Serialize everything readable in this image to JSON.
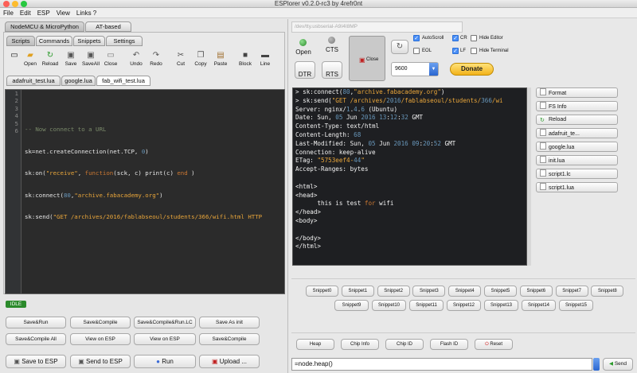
{
  "window": {
    "title": "ESPlorer v0.2.0-rc3 by 4refr0nt"
  },
  "menu": [
    "File",
    "Edit",
    "ESP",
    "View",
    "Links ?"
  ],
  "left": {
    "firmware_tabs": [
      "NodeMCU & MicroPython",
      "AT-based"
    ],
    "sub_tabs": [
      "Scripts",
      "Commands",
      "Snippets",
      "Settings"
    ],
    "toolbar": [
      {
        "label": "Open",
        "icon": "new-file-icon"
      },
      {
        "label": "Open",
        "icon": "open-folder-icon"
      },
      {
        "label": "Reload",
        "icon": "reload-icon"
      },
      {
        "label": "Save",
        "icon": "save-icon"
      },
      {
        "label": "SaveAll",
        "icon": "save-all-icon"
      },
      {
        "label": "Close",
        "icon": "close-file-icon"
      },
      {
        "label": "Undo",
        "icon": "undo-icon"
      },
      {
        "label": "Redo",
        "icon": "redo-icon"
      },
      {
        "label": "Cut",
        "icon": "cut-icon"
      },
      {
        "label": "Copy",
        "icon": "copy-icon"
      },
      {
        "label": "Paste",
        "icon": "paste-icon"
      },
      {
        "label": "Block",
        "icon": "block-icon"
      },
      {
        "label": "Line",
        "icon": "line-icon"
      }
    ],
    "file_tabs": [
      "adafruit_test.lua",
      "google.lua",
      "fab_wifi_test.lua"
    ],
    "line_numbers": [
      "1",
      "2",
      "3",
      "4",
      "5",
      "6"
    ],
    "status": "IDLE",
    "actions_row1": [
      "Save&Run",
      "Save&Compile",
      "Save&Compile&Run.LC",
      "Save As init"
    ],
    "actions_row2": [
      "Save&Compile All",
      "View on ESP",
      "View on ESP",
      "Save&Compile"
    ],
    "actions_row3": [
      "Save to ESP",
      "Send to ESP",
      "Run",
      "Upload ..."
    ]
  },
  "right": {
    "port": "/dev/tty.usbserial-A9I4I8MP",
    "open_label": "Open",
    "cts_label": "CTS",
    "dtr_label": "DTR",
    "rts_label": "RTS",
    "close_label": "Close",
    "checkboxes": [
      {
        "label": "AutoScroll",
        "checked": true
      },
      {
        "label": "EOL",
        "checked": false
      },
      {
        "label": "CR",
        "checked": true
      },
      {
        "label": "LF",
        "checked": true
      },
      {
        "label": "Hide Editor",
        "checked": false
      },
      {
        "label": "Hide Terminal",
        "checked": false
      }
    ],
    "baud": "9600",
    "donate_label": "Donate",
    "terminal_lines": [
      "> sk:connect(80,\"archive.fabacademy.org\")",
      "> sk:send(\"GET /archives/2016/fablabseoul/students/366/wi",
      "Server: nginx/1.4.6 (Ubuntu)",
      "Date: Sun, 05 Jun 2016 13:12:32 GMT",
      "Content-Type: text/html",
      "Content-Length: 68",
      "Last-Modified: Sun, 05 Jun 2016 09:20:52 GMT",
      "Connection: keep-alive",
      "ETag: \"5753eef4-44\"",
      "Accept-Ranges: bytes",
      "",
      "<html>",
      "<head>",
      "      this is test for wifi",
      "</head>",
      "<body>",
      "",
      "</body>",
      "</html>"
    ],
    "side_buttons": [
      "Format",
      "FS Info",
      "Reload",
      "adafruit_te...",
      "google.lua",
      "init.lua",
      "script1.lc",
      "script1.lua"
    ],
    "snippets_row1": [
      "Snippet0",
      "Snippet1",
      "Snippet2",
      "Snippet3",
      "Snippet4",
      "Snippet5",
      "Snippet6",
      "Snippet7",
      "Snippet8"
    ],
    "snippets_row2": [
      "Snippet9",
      "Snippet10",
      "Snippet11",
      "Snippet12",
      "Snippet13",
      "Snippet14",
      "Snippet15"
    ],
    "bottom_buttons": [
      "Heap",
      "Chip Info",
      "Chip ID",
      "Flash ID",
      "Reset"
    ],
    "command_value": "=node.heap()",
    "send_label": "Send"
  }
}
